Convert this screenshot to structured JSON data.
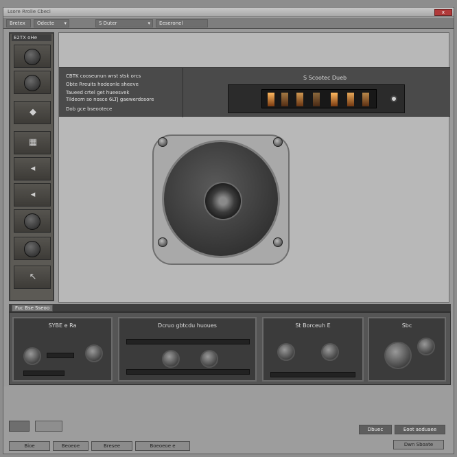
{
  "window": {
    "title": "Lsore Rrolie Cbeci",
    "close_label": "x"
  },
  "toolbar": {
    "items": [
      {
        "label": "Bretex"
      },
      {
        "label": "Odecte"
      },
      {
        "label": "S Duter"
      },
      {
        "label": "Eeseronel"
      }
    ]
  },
  "tool_panel": {
    "title": "E2TX oHe",
    "icons": [
      "dial-knob-icon",
      "dial-knob-icon",
      "pointer-icon",
      "grid-icon",
      "pointer-icon",
      "pointer-icon",
      "dial-knob-icon",
      "dial-knob-icon",
      "arrow-icon"
    ]
  },
  "info_bar": {
    "lines": [
      "CBTK cooseunun wrst stsk orcs",
      "Obte Rreuits hodeonle sheeve",
      "Taueed crtel get hueesvek",
      "Tildeom so nosce 6LTJ  gaewerdosore",
      "Dob gce bseootece"
    ],
    "display_title": "S Scootec Dueb"
  },
  "section_bar": {
    "label": "Fuc Bse Sseoo"
  },
  "panels": [
    {
      "label": "SYBE e Ra"
    },
    {
      "label": "Dcruo gbtcdu huoues"
    },
    {
      "label": "St Borceuh E"
    },
    {
      "label": "Sbc"
    }
  ],
  "footer": {
    "buttons": [
      "Bioe",
      "Beoeoe",
      "Bresee",
      "Boeoeoe e"
    ],
    "right_buttons": [
      "Dbuec",
      "Eoot aoduaee"
    ],
    "corner_button": "Dwn Sboate"
  },
  "colors": {
    "accent": "#b03a3a",
    "display_glow": "#ffb960"
  }
}
